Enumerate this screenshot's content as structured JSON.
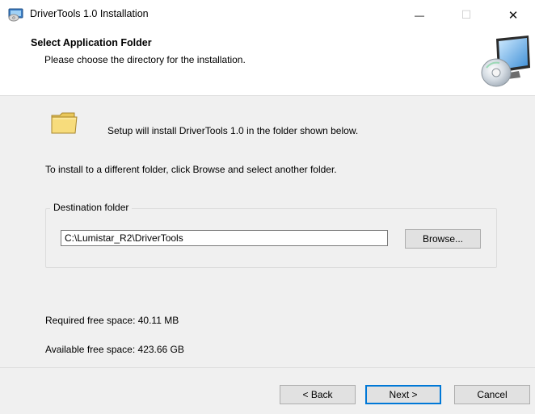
{
  "window": {
    "title": "DriverTools 1.0 Installation",
    "minimize_glyph": "—",
    "maximize_glyph": "☐",
    "close_glyph": "✕"
  },
  "header": {
    "title": "Select Application Folder",
    "subtitle": "Please choose the directory for the installation."
  },
  "content": {
    "setup_text": "Setup will install DriverTools 1.0 in the folder shown below.",
    "instruction_text": "To install to a different folder, click Browse and select another folder.",
    "group_label": "Destination folder",
    "destination_path": "C:\\Lumistar_R2\\DriverTools",
    "browse_label": "Browse...",
    "required_space": "Required free space: 40.11 MB",
    "available_space": "Available free space: 423.66 GB"
  },
  "footer": {
    "back_label": "< Back",
    "next_label": "Next >",
    "cancel_label": "Cancel"
  },
  "icons": {
    "app": "installer-disc-icon",
    "header": "monitor-disc-icon",
    "folder": "folder-icon"
  },
  "colors": {
    "accent": "#0078d7",
    "button_bg": "#e1e1e1",
    "dialog_bg": "#f0f0f0"
  }
}
